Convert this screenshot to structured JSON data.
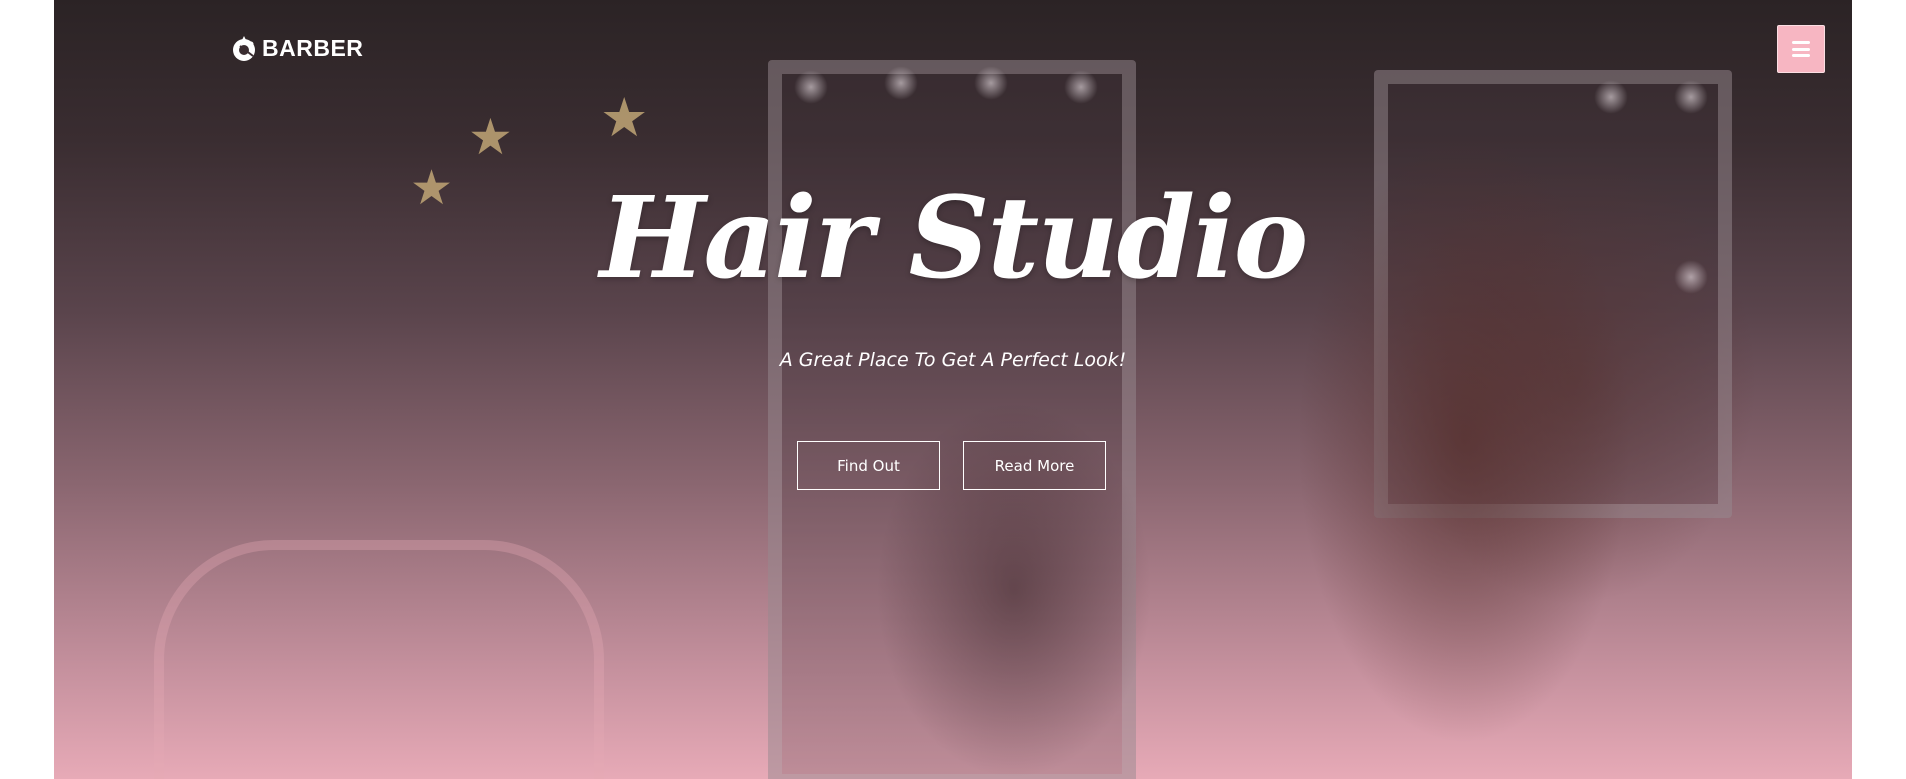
{
  "brand": {
    "logo_icon": "barber-scissors-logo-icon",
    "name": "BARBER"
  },
  "header": {
    "menu_icon": "hamburger-menu-icon",
    "menu_button_color": "#f7b6c2"
  },
  "hero": {
    "title": "Hair Studio",
    "subtitle": "A Great Place To Get A Perfect Look!",
    "buttons": [
      {
        "label": "Find Out"
      },
      {
        "label": "Read More"
      }
    ],
    "overlay_color_top": "#2b2325",
    "overlay_color_bottom": "#e7aab7"
  }
}
